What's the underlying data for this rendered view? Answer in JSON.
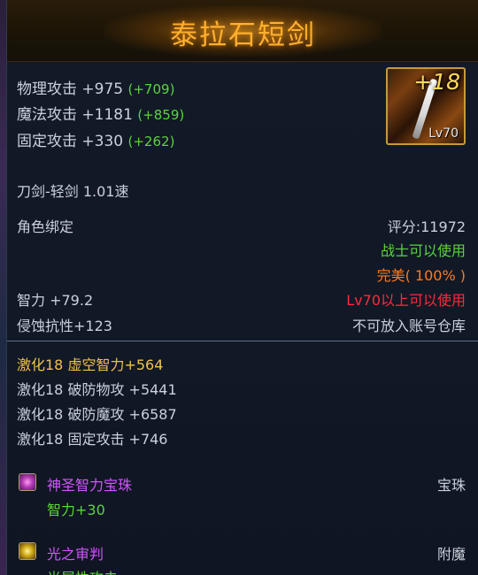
{
  "item": {
    "name": "泰拉石短剑",
    "enhance": "+18",
    "level": "Lv70"
  },
  "stats": [
    {
      "label": "物理攻击 +975",
      "bonus": "(+709)"
    },
    {
      "label": "魔法攻击 +1181",
      "bonus": "(+859)"
    },
    {
      "label": "固定攻击 +330",
      "bonus": "(+262)"
    }
  ],
  "weapon_type": "刀剑-轻剑  1.01速",
  "binding": "角色绑定",
  "score": "评分:11972",
  "usable_by": "战士可以使用",
  "quality": "完美( 100% )",
  "intellect": "智力 +79.2",
  "level_req": "Lv70以上可以使用",
  "corrosion": "侵蚀抗性+123",
  "storage": "不可放入账号仓库",
  "activations": [
    "激化18 虚空智力+564",
    "激化18 破防物攻 +5441",
    "激化18 破防魔攻 +6587",
    "激化18 固定攻击 +746"
  ],
  "gem": {
    "name": "神圣智力宝珠",
    "type": "宝珠",
    "effect": "智力+30"
  },
  "enchant": {
    "name": "光之审判",
    "type": "附魔",
    "effect": "光属性攻击"
  },
  "colors": {
    "title": "#ffb02e",
    "bonus_green": "#5bd43e",
    "quality_orange": "#ff7a1a",
    "requirement_red": "#ff2a3a",
    "activation_gold": "#f2c14e",
    "gem_purple": "#d254ff"
  },
  "icons": [
    "sword-item-icon",
    "gem-icon",
    "enchant-icon"
  ]
}
